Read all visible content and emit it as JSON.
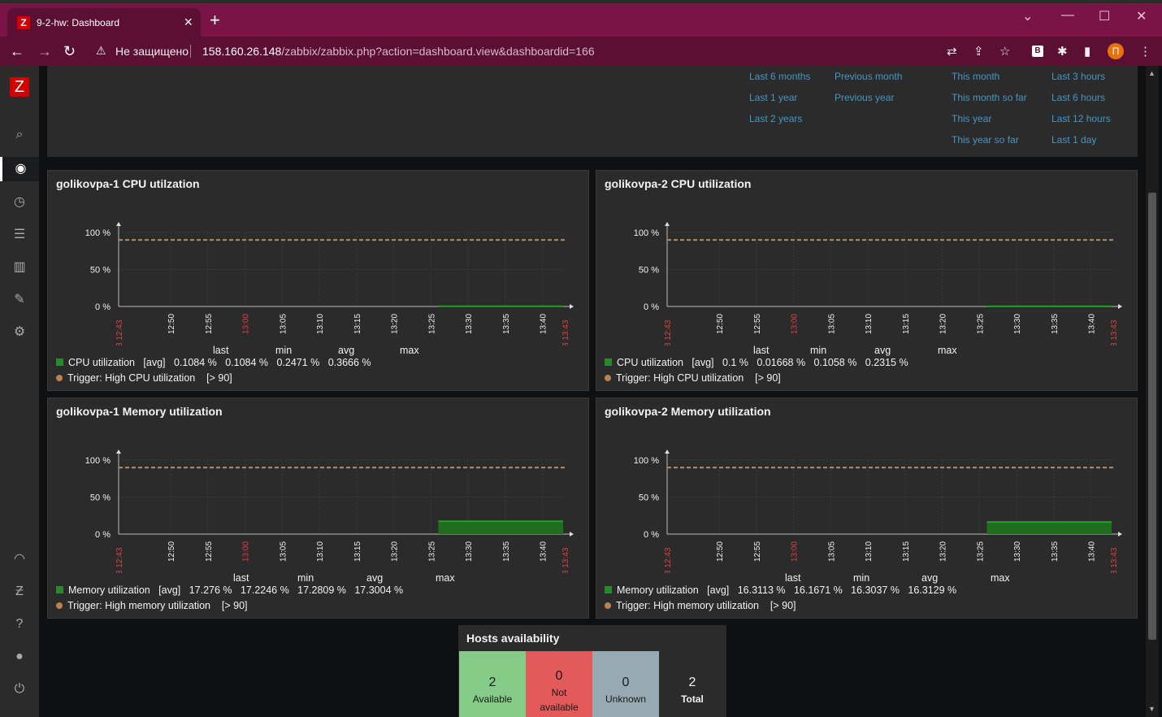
{
  "browser": {
    "tab_title": "9-2-hw: Dashboard",
    "favicon_letter": "Z",
    "insecure_label": "Не защищено",
    "url_host": "158.160.26.148",
    "url_path": "/zabbix/zabbix.php?action=dashboard.view&dashboardid=166",
    "profile_letter": "П",
    "extension_letter": "В"
  },
  "sidebar": {
    "logo": "Z"
  },
  "time_presets": {
    "col1": [
      "Last 6 months",
      "Last 1 year",
      "Last 2 years"
    ],
    "col2": [
      "Previous month",
      "Previous year"
    ],
    "col3": [
      "This month",
      "This month so far",
      "This year",
      "This year so far"
    ],
    "col4": [
      "Last 3 hours",
      "Last 6 hours",
      "Last 12 hours",
      "Last 1 day"
    ]
  },
  "graph_axis": {
    "y_labels": [
      "100 %",
      "50 %",
      "0 %"
    ],
    "x_labels": [
      "12:50",
      "12:55",
      "13:00",
      "13:05",
      "13:10",
      "13:15",
      "13:20",
      "13:25",
      "13:30",
      "13:35",
      "13:40"
    ],
    "x_start": "02-03 12:43",
    "x_end": "02-03 13:43",
    "highlight_label": "13:00",
    "trigger_threshold": 90
  },
  "legend_heads": {
    "last": "last",
    "min": "min",
    "avg": "avg",
    "max": "max"
  },
  "widgets": [
    {
      "title": "golikovpa-1 CPU utilzation",
      "item": "CPU utilization",
      "func": "[avg]",
      "last": "0.1084 %",
      "min": "0.1084 %",
      "avg": "0.2471 %",
      "max": "0.3666 %",
      "trigger": "Trigger: High CPU utilization",
      "trigger_cond": "[> 90]",
      "data_from": "13:26",
      "data_level": 0.3
    },
    {
      "title": "golikovpa-2 CPU utilization",
      "item": "CPU utilization",
      "func": "[avg]",
      "last": "0.1 %",
      "min": "0.01668 %",
      "avg": "0.1058 %",
      "max": "0.2315 %",
      "trigger": "Trigger: High CPU utilization",
      "trigger_cond": "[> 90]",
      "data_from": "13:26",
      "data_level": 0.2
    },
    {
      "title": "golikovpa-1 Memory utilization",
      "item": "Memory utilization",
      "func": "[avg]",
      "last": "17.276 %",
      "min": "17.2246 %",
      "avg": "17.2809 %",
      "max": "17.3004 %",
      "trigger": "Trigger: High memory utilization",
      "trigger_cond": "[> 90]",
      "data_from": "13:26",
      "data_level": 17.28
    },
    {
      "title": "golikovpa-2 Memory utilization",
      "item": "Memory utilization",
      "func": "[avg]",
      "last": "16.3113 %",
      "min": "16.1671 %",
      "avg": "16.3037 %",
      "max": "16.3129 %",
      "trigger": "Trigger: High memory utilization",
      "trigger_cond": "[> 90]",
      "data_from": "13:26",
      "data_level": 16.3
    }
  ],
  "hosts_availability": {
    "title": "Hosts availability",
    "cells": [
      {
        "count": "2",
        "label": "Available",
        "color": "#86cc89"
      },
      {
        "count": "0",
        "label": "Not available",
        "color": "#e45959"
      },
      {
        "count": "0",
        "label": "Unknown",
        "color": "#97aab3"
      },
      {
        "count": "2",
        "label": "Total",
        "color": "#2b2b2b"
      }
    ]
  },
  "colors": {
    "grid_line": "#3a3a3a",
    "trigger_line": "#c8864f",
    "data_fill": "#1f6e1f",
    "data_line": "#2a9a2a",
    "axis_red": "#d64545",
    "link": "#4796c4"
  }
}
